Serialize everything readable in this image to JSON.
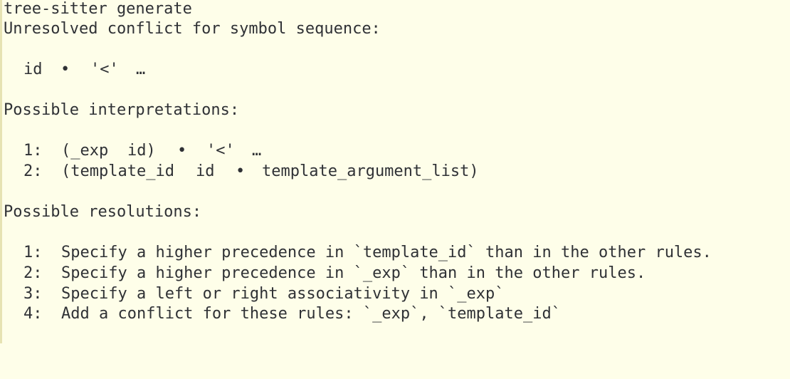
{
  "terminal": {
    "command": "tree-sitter generate",
    "conflict_header": "Unresolved conflict for symbol sequence:",
    "sequence": {
      "tokens": [
        "id",
        "•",
        "'<'",
        "…"
      ]
    },
    "interpretations_header": "Possible interpretations:",
    "interpretations": [
      {
        "num": "1:",
        "tokens": [
          "(_exp",
          "id)",
          "•",
          "'<'",
          "…"
        ]
      },
      {
        "num": "2:",
        "tokens": [
          "(template_id",
          "id",
          "•",
          "template_argument_list)"
        ]
      }
    ],
    "resolutions_header": "Possible resolutions:",
    "resolutions": [
      {
        "num": "1:",
        "text": "Specify a higher precedence in `template_id` than in the other rules."
      },
      {
        "num": "2:",
        "text": "Specify a higher precedence in `_exp` than in the other rules."
      },
      {
        "num": "3:",
        "text": "Specify a left or right associativity in `_exp`"
      },
      {
        "num": "4:",
        "text": "Add a conflict for these rules: `_exp`, `template_id`"
      }
    ]
  }
}
